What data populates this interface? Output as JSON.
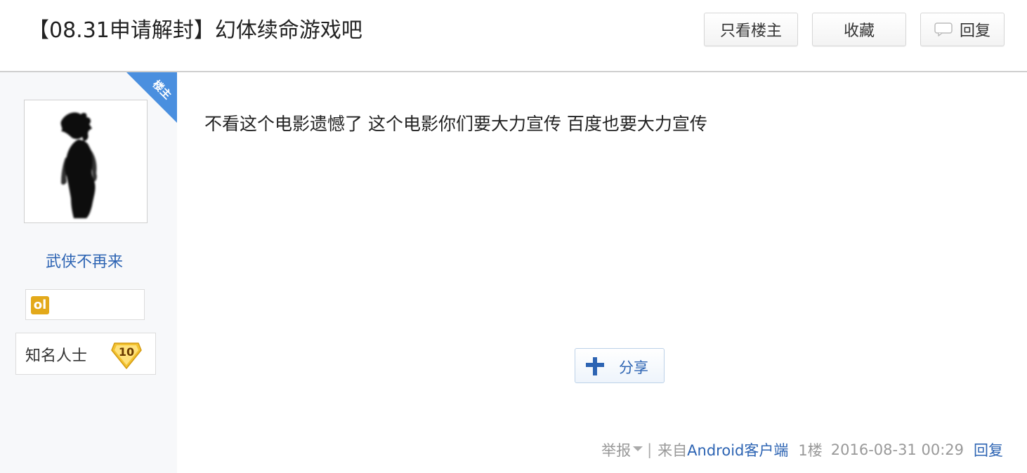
{
  "thread": {
    "title": "【08.31申请解封】幻体续命游戏吧"
  },
  "header_buttons": {
    "only_op": "只看楼主",
    "favorite": "收藏",
    "reply": "回复"
  },
  "author": {
    "op_badge": "楼主",
    "username": "武侠不再来",
    "level_title": "知名人士",
    "level_number": "10",
    "badge_icon_text": "ol"
  },
  "post": {
    "content": "不看这个电影遗憾了 这个电影你们要大力宣传 百度也要大力宣传",
    "share_label": "分享"
  },
  "meta": {
    "report": "举报",
    "separator": "|",
    "from_prefix": "来自",
    "client": "Android客户端",
    "floor": "1楼",
    "timestamp": "2016-08-31 00:29",
    "reply": "回复"
  },
  "colors": {
    "link_blue": "#2d64b3",
    "badge_blue": "#4a8fdf",
    "level_gold": "#f2c230",
    "sidebar_bg": "#f7f8fa"
  }
}
